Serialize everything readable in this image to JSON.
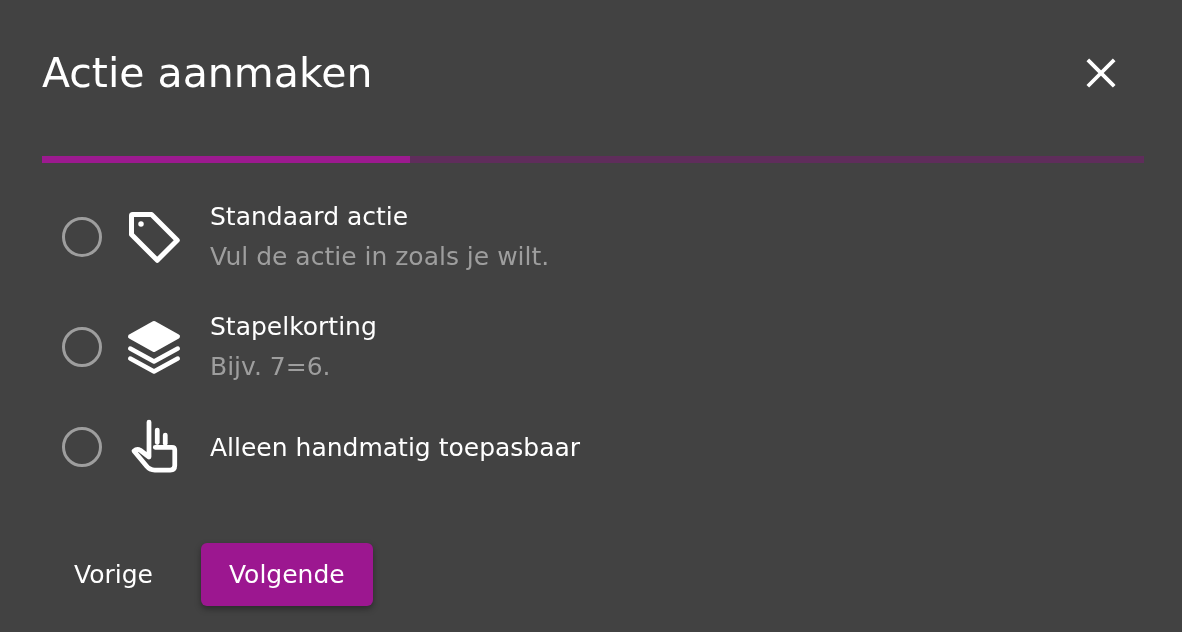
{
  "dialog": {
    "title": "Actie aanmaken"
  },
  "progress": {
    "level": 0.334
  },
  "options": [
    {
      "title": "Standaard actie",
      "description": "Vul de actie in zoals je wilt.",
      "selected": false
    },
    {
      "title": "Stapelkorting",
      "description": "Bijv. 7=6.",
      "selected": false
    },
    {
      "title": "Alleen handmatig toepasbaar",
      "selected": false
    }
  ],
  "buttons": [
    {
      "label": "Vorige",
      "kind": "text"
    },
    {
      "label": "Volgende",
      "kind": "primary"
    }
  ]
}
